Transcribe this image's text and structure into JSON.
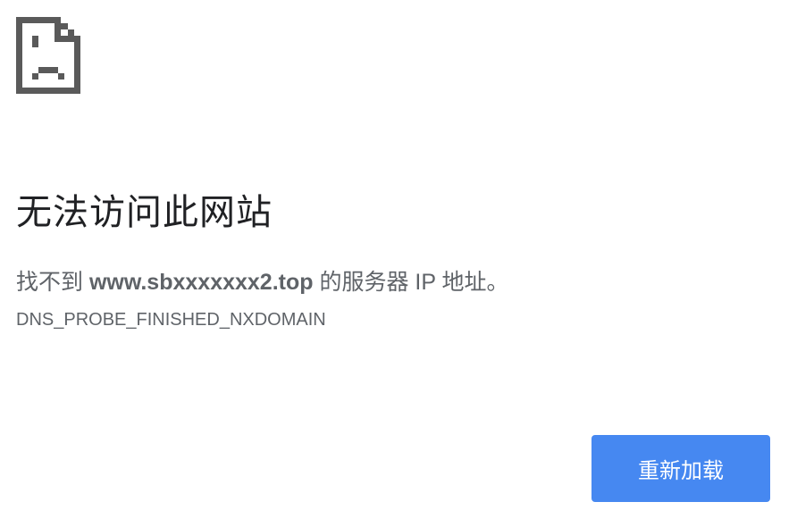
{
  "icon": "sad-page-icon",
  "title": "无法访问此网站",
  "message": {
    "prefix": "找不到 ",
    "domain": "www.sbxxxxxxx2.top",
    "suffix": " 的服务器 IP 地址。"
  },
  "error_code": "DNS_PROBE_FINISHED_NXDOMAIN",
  "reload_button": "重新加载",
  "colors": {
    "accent": "#4688f1",
    "icon": "#5a5a5a",
    "text": "#5f6368"
  }
}
